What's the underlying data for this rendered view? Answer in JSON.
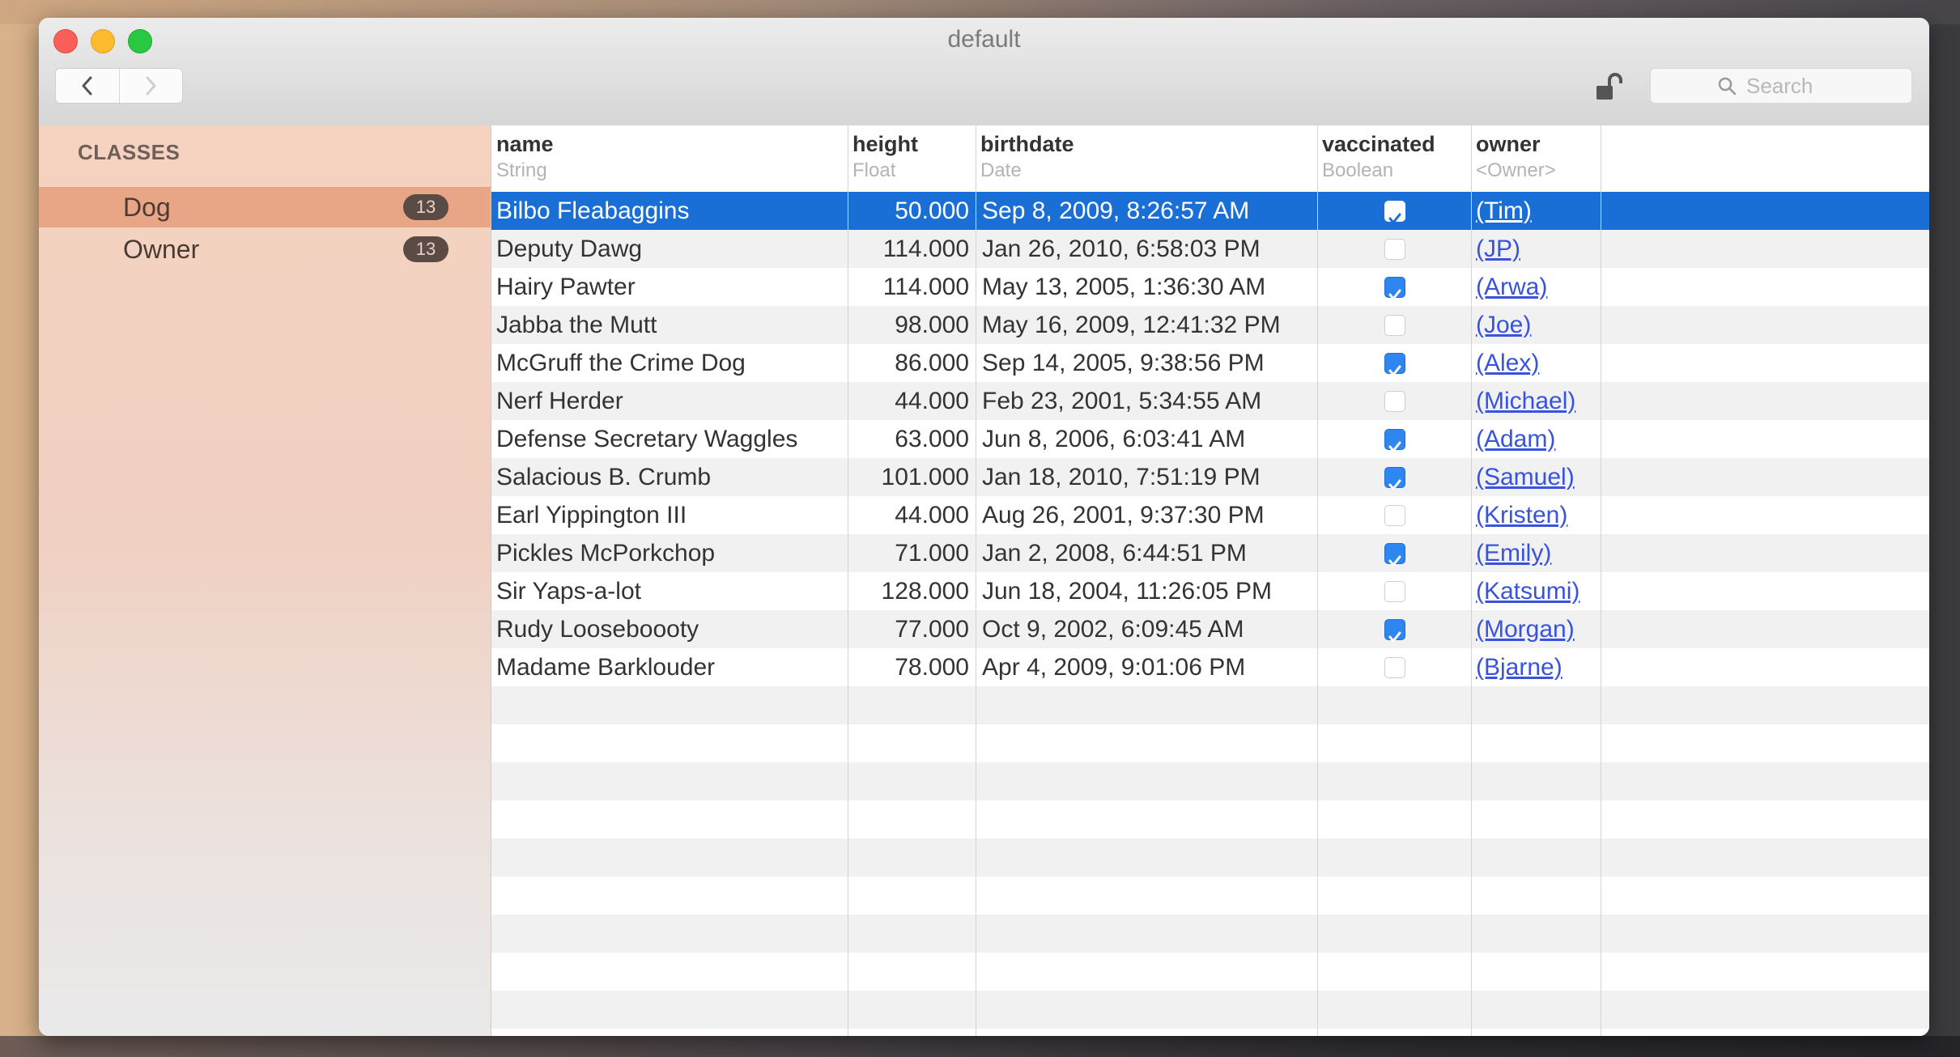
{
  "window": {
    "title": "default"
  },
  "search": {
    "placeholder": "Search"
  },
  "sidebar": {
    "heading": "CLASSES",
    "items": [
      {
        "label": "Dog",
        "count": "13",
        "selected": true
      },
      {
        "label": "Owner",
        "count": "13",
        "selected": false
      }
    ]
  },
  "table": {
    "columns": [
      {
        "name": "name",
        "type": "String"
      },
      {
        "name": "height",
        "type": "Float"
      },
      {
        "name": "birthdate",
        "type": "Date"
      },
      {
        "name": "vaccinated",
        "type": "Boolean"
      },
      {
        "name": "owner",
        "type": "<Owner>"
      }
    ],
    "rows": [
      {
        "name": "Bilbo Fleabaggins",
        "height": "50.000",
        "birthdate": "Sep 8, 2009, 8:26:57 AM",
        "vaccinated": true,
        "owner": "(Tim)"
      },
      {
        "name": "Deputy Dawg",
        "height": "114.000",
        "birthdate": "Jan 26, 2010, 6:58:03 PM",
        "vaccinated": false,
        "owner": "(JP)"
      },
      {
        "name": "Hairy Pawter",
        "height": "114.000",
        "birthdate": "May 13, 2005, 1:36:30 AM",
        "vaccinated": true,
        "owner": "(Arwa)"
      },
      {
        "name": "Jabba the Mutt",
        "height": "98.000",
        "birthdate": "May 16, 2009, 12:41:32 PM",
        "vaccinated": false,
        "owner": "(Joe)"
      },
      {
        "name": "McGruff the Crime Dog",
        "height": "86.000",
        "birthdate": "Sep 14, 2005, 9:38:56 PM",
        "vaccinated": true,
        "owner": "(Alex)"
      },
      {
        "name": "Nerf Herder",
        "height": "44.000",
        "birthdate": "Feb 23, 2001, 5:34:55 AM",
        "vaccinated": false,
        "owner": "(Michael)"
      },
      {
        "name": "Defense Secretary Waggles",
        "height": "63.000",
        "birthdate": "Jun 8, 2006, 6:03:41 AM",
        "vaccinated": true,
        "owner": "(Adam)"
      },
      {
        "name": "Salacious B. Crumb",
        "height": "101.000",
        "birthdate": "Jan 18, 2010, 7:51:19 PM",
        "vaccinated": true,
        "owner": "(Samuel)"
      },
      {
        "name": "Earl Yippington III",
        "height": "44.000",
        "birthdate": "Aug 26, 2001, 9:37:30 PM",
        "vaccinated": false,
        "owner": "(Kristen)"
      },
      {
        "name": "Pickles McPorkchop",
        "height": "71.000",
        "birthdate": "Jan 2, 2008, 6:44:51 PM",
        "vaccinated": true,
        "owner": "(Emily)"
      },
      {
        "name": "Sir Yaps-a-lot",
        "height": "128.000",
        "birthdate": "Jun 18, 2004, 11:26:05 PM",
        "vaccinated": false,
        "owner": "(Katsumi)"
      },
      {
        "name": "Rudy Looseboooty",
        "height": "77.000",
        "birthdate": "Oct 9, 2002, 6:09:45 AM",
        "vaccinated": true,
        "owner": "(Morgan)"
      },
      {
        "name": "Madame Barklouder",
        "height": "78.000",
        "birthdate": "Apr 4, 2009, 9:01:06 PM",
        "vaccinated": false,
        "owner": "(Bjarne)"
      }
    ],
    "selected_row": 0
  },
  "colors": {
    "selection": "#1a6fd6",
    "sidebar_selection": "#e8a687",
    "link": "#3753e0",
    "checkbox_on": "#2e86f0"
  },
  "icons": {
    "back": "chevron-left-icon",
    "forward": "chevron-right-icon",
    "lock": "unlocked-padlock-icon",
    "search": "magnifier-icon"
  }
}
